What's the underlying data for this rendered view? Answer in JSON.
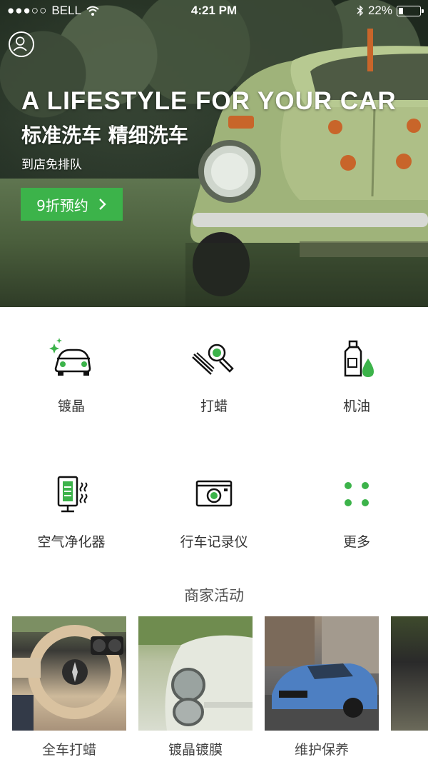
{
  "status_bar": {
    "carrier": "BELL",
    "time": "4:21 PM",
    "battery_text": "22%",
    "battery_level": 0.22
  },
  "hero": {
    "title": "A LIFESTYLE FOR YOUR CAR",
    "subtitle": "标准洗车 精细洗车",
    "note": "到店免排队",
    "cta_label": "9折预约",
    "cta_icon": "chevron-right-icon",
    "avatar_icon": "user-icon"
  },
  "services": [
    {
      "label": "镀晶",
      "icon": "car-sparkle-icon"
    },
    {
      "label": "打蜡",
      "icon": "wax-polisher-icon"
    },
    {
      "label": "机油",
      "icon": "oil-bottle-icon"
    },
    {
      "label": "空气净化器",
      "icon": "air-purifier-icon"
    },
    {
      "label": "行车记录仪",
      "icon": "dashcam-icon"
    },
    {
      "label": "更多",
      "icon": "more-dots-icon"
    }
  ],
  "activities": {
    "title": "商家活动",
    "items": [
      {
        "label": "全车打蜡"
      },
      {
        "label": "镀晶镀膜"
      },
      {
        "label": "维护保养"
      },
      {
        "label": ""
      }
    ]
  },
  "colors": {
    "accent": "#3cb34a",
    "text": "#333333"
  }
}
